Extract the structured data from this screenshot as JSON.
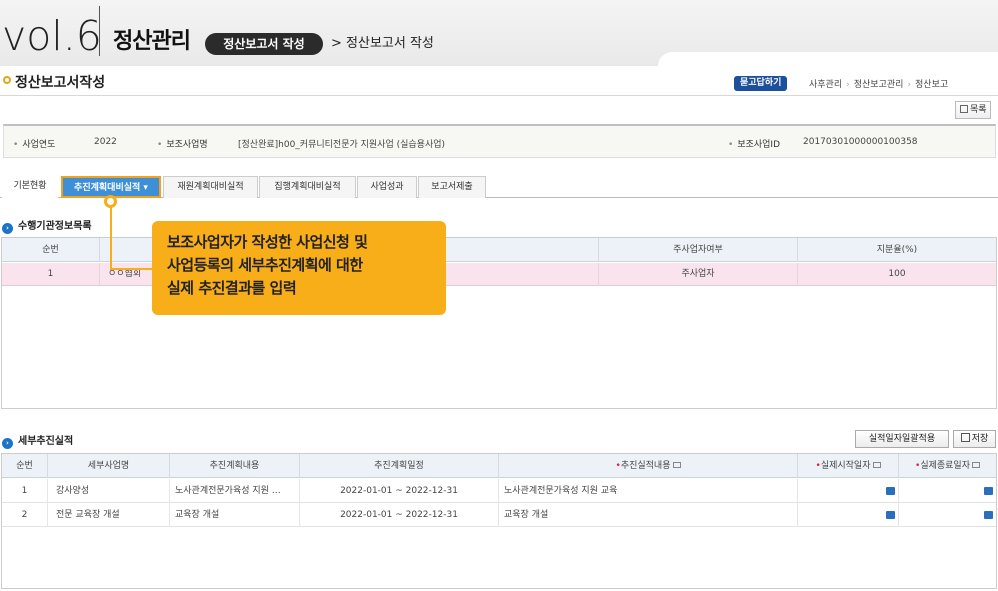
{
  "header": {
    "vol": "vol.6",
    "title": "정산관리",
    "pill": "정산보고서 작성",
    "crumb": "> 정산보고서 작성"
  },
  "page": {
    "title": "정산보고서작성",
    "help": "묻고답하기",
    "breadcrumb": [
      "사후관리",
      "정산보고관리",
      "정산보고"
    ],
    "list_button": "목록"
  },
  "info": {
    "year_label": "사업연도",
    "year_value": "2022",
    "project_label": "보조사업명",
    "project_value": "[정산완료]h00_커뮤니티전문가 지원사업 (실습용사업)",
    "id_label": "보조사업ID",
    "id_value": "20170301000000100358"
  },
  "tabs": [
    {
      "label": "기본현황"
    },
    {
      "label": "추진계획대비실적 ▾"
    },
    {
      "label": "재원계획대비실적"
    },
    {
      "label": "집행계획대비실적"
    },
    {
      "label": "사업성과"
    },
    {
      "label": "보고서제출"
    }
  ],
  "section1": {
    "title": "수행기관정보목록",
    "columns": [
      "순번",
      "",
      "주사업자여부",
      "지분율(%)"
    ],
    "row": {
      "no": "1",
      "name": "ㅇㅇ협회",
      "main": "주사업자",
      "share": "100"
    }
  },
  "callout": {
    "lines": [
      "보조사업자가 작성한 사업신청 및",
      "사업등록의 세부추진계획에 대한",
      "실제 추진결과를 입력"
    ]
  },
  "section2": {
    "title": "세부추진실적",
    "bulk_button": "실적일자일괄적용",
    "save_button": "저장",
    "columns": [
      "순번",
      "세부사업명",
      "추진계획내용",
      "추진계획일정",
      "추진실적내용",
      "실제시작일자",
      "실제종료일자"
    ],
    "rows": [
      {
        "no": "1",
        "name": "강사양성",
        "plan": "노사관계전문가육성 지원 …",
        "schedule": "2022-01-01 ~ 2022-12-31",
        "result": "노사관계전문가육성 지원 교육"
      },
      {
        "no": "2",
        "name": "전문 교육장 개설",
        "plan": "교육장 개설",
        "schedule": "2022-01-01 ~ 2022-12-31",
        "result": "교육장 개설"
      }
    ]
  },
  "colors": {
    "accent_tab": "#3d8fd8",
    "callout": "#f8ae18",
    "help_badge": "#1c4f9c"
  }
}
